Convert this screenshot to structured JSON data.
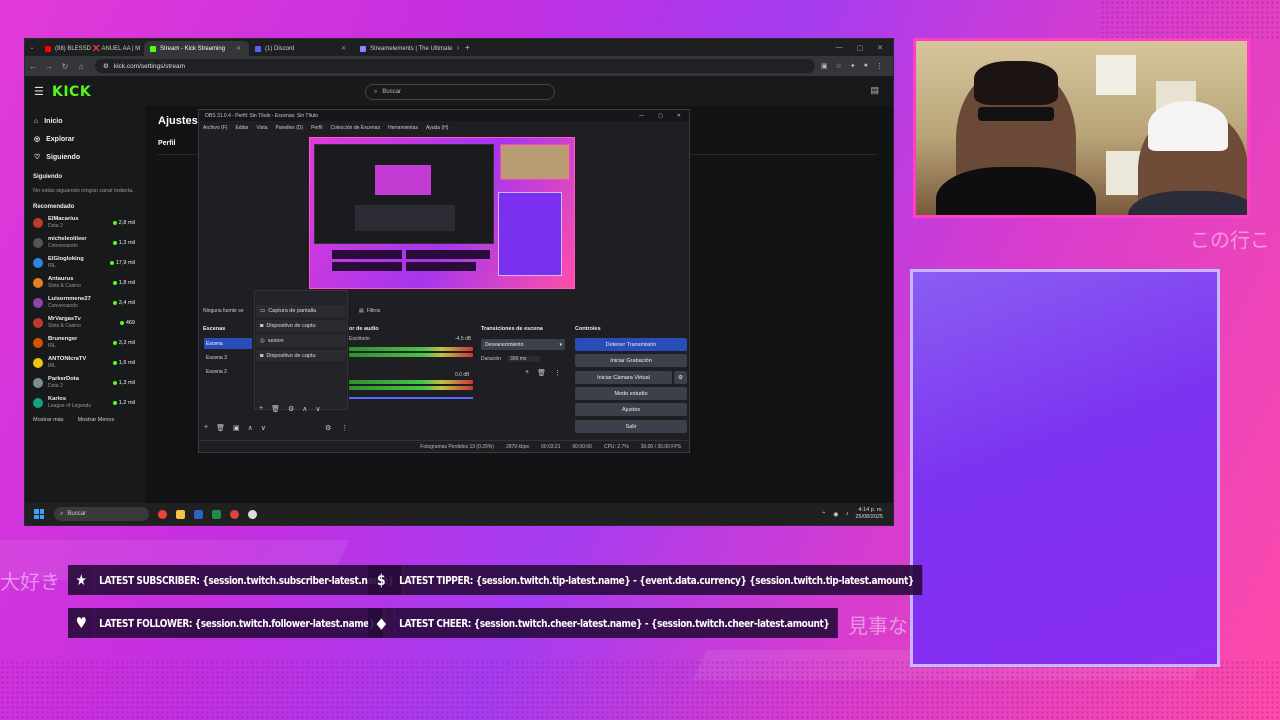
{
  "browser": {
    "tabs": [
      {
        "label": "(88) BLESSD ❌ ANUEL AA | M",
        "color": "#ff0000",
        "active": false
      },
      {
        "label": "Stream - Kick Streaming",
        "color": "#53fc18",
        "active": true
      },
      {
        "label": "(1) Discord",
        "color": "#5865f2",
        "active": false
      },
      {
        "label": "Streamelements | The Ultimate",
        "color": "#8888ff",
        "active": false
      }
    ],
    "new_tab": "+",
    "url": "kick.com/settings/stream"
  },
  "kick": {
    "logo": "KICK",
    "search_placeholder": "Buscar",
    "nav": [
      {
        "label": "Inicio",
        "icon": "home-icon"
      },
      {
        "label": "Explorar",
        "icon": "compass-icon"
      },
      {
        "label": "Siguiendo",
        "icon": "heart-icon"
      }
    ],
    "following_heading": "Siguiendo",
    "following_note": "No estás siguiendo ningún canal todavía.",
    "recommended_heading": "Recomendado",
    "recommended": [
      {
        "name": "ElMacarius",
        "category": "Dota 2",
        "viewers": "2,8 mil",
        "color": "#c0392b"
      },
      {
        "name": "micheleolileer",
        "category": "Conversando",
        "viewers": "1,3 mil",
        "color": "#555555"
      },
      {
        "name": "ElGlogloking",
        "category": "IRL",
        "viewers": "17,9 mil",
        "color": "#2e86de"
      },
      {
        "name": "Antaurus",
        "category": "Slots & Casino",
        "viewers": "1,8 mil",
        "color": "#e67e22"
      },
      {
        "name": "Luisornmene27",
        "category": "Conversando",
        "viewers": "3,4 mil",
        "color": "#8e44ad"
      },
      {
        "name": "MrVargasTv",
        "category": "Slots & Casino",
        "viewers": "469",
        "color": "#c0392b"
      },
      {
        "name": "Brunenger",
        "category": "IRL",
        "viewers": "3,3 mil",
        "color": "#d35400"
      },
      {
        "name": "ANTONIcraTV",
        "category": "IRL",
        "viewers": "1,6 mil",
        "color": "#f1c40f"
      },
      {
        "name": "ParkerDota",
        "category": "Dota 2",
        "viewers": "1,3 mil",
        "color": "#7f8c8d"
      },
      {
        "name": "Karlos",
        "category": "League of Legends",
        "viewers": "1,2 mil",
        "color": "#16a085"
      }
    ],
    "show_more": "Mostrar más",
    "show_less": "Mostrar Menos",
    "page_title": "Ajustes",
    "profile_tab": "Perfil"
  },
  "obs": {
    "title": "OBS 31.0.4 - Perfil: Sin Título - Escenas: Sin Título",
    "menu": [
      "Archivo (F)",
      "Editar",
      "Vista",
      "Panelles (D)",
      "Perfil",
      "Colección de Escenas",
      "Herramientas",
      "Ayuda (H)"
    ],
    "no_source": "Ninguna fuente se",
    "filters": "Filtros",
    "scenes_heading": "Escenas",
    "scenes": [
      "Escena",
      "Escena 3",
      "Escena 2"
    ],
    "sources": [
      "Captura de pantalla",
      "Dispositivo de captu",
      "sesion",
      "Dispositivo de captu"
    ],
    "audio_heading": "or de audio",
    "audio_track": "Escritorio",
    "audio_db1": "-4.5 dB",
    "audio_db2": "0.0 dB",
    "transitions_heading": "Transiciones de escena",
    "transition": "Desvanecimiento",
    "duration_label": "Duración",
    "duration_value": "300 ms",
    "controls_heading": "Controles",
    "controls": [
      "Detener Transmisión",
      "Iniciar Grabación",
      "Iniciar Cámara Virtual",
      "Modo estudio",
      "Ajustes",
      "Salir"
    ],
    "status_frames": "Fotogramas Perdidos 13 (0.29%)",
    "status_kbps": "2879 kbps",
    "status_live": "00:03:21",
    "status_rec": "00:00:00",
    "status_cpu": "CPU: 2.7%",
    "status_fps": "30.00 / 30.00 FPS"
  },
  "taskbar": {
    "search": "Buscar",
    "time": "4:14 p. m.",
    "date": "25/08/2025"
  },
  "overlay": {
    "jp_left": "大好き",
    "jp_right_top": "この行こ",
    "jp_right_bottom": "見事な",
    "alerts": {
      "subscriber": "LATEST SUBSCRIBER: {session.twitch.subscriber-latest.name}",
      "tipper": "LATEST TIPPER: {session.twitch.tip-latest.name} - {event.data.currency} {session.twitch.tip-latest.amount}",
      "follower": "LATEST FOLLOWER: {session.twitch.follower-latest.name}",
      "cheer": "LATEST CHEER: {session.twitch.cheer-latest.name} - {session.twitch.cheer-latest.amount}"
    }
  },
  "colors": {
    "kick_green": "#53fc18",
    "obs_primary": "#284cb8",
    "overlay_pink": "#ff3fc4",
    "frame_border": "#c7b9ff"
  }
}
